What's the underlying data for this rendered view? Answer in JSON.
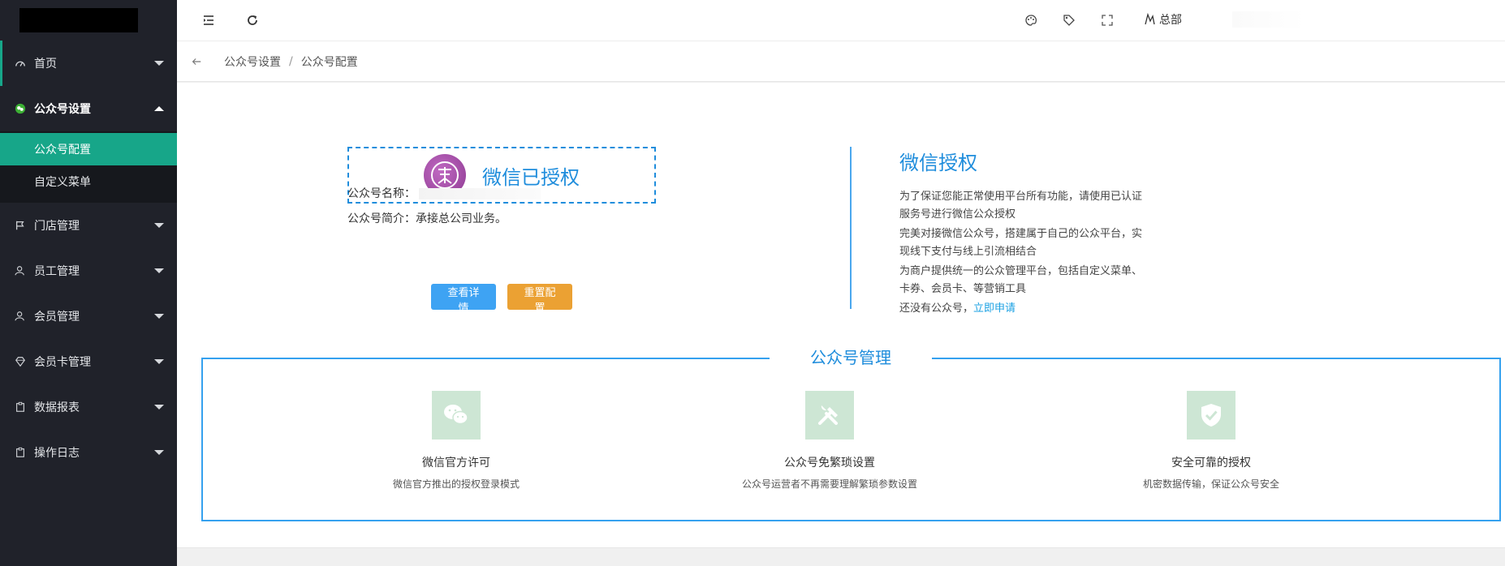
{
  "sidebar": {
    "items": [
      {
        "label": "首页",
        "icon": "dashboard-icon"
      },
      {
        "label": "公众号设置",
        "icon": "wechat-icon"
      },
      {
        "label": "门店管理",
        "icon": "flag-icon"
      },
      {
        "label": "员工管理",
        "icon": "user-icon"
      },
      {
        "label": "会员管理",
        "icon": "user-icon"
      },
      {
        "label": "会员卡管理",
        "icon": "diamond-icon"
      },
      {
        "label": "数据报表",
        "icon": "clipboard-icon"
      },
      {
        "label": "操作日志",
        "icon": "clipboard-icon"
      }
    ],
    "submenu": [
      {
        "label": "公众号配置"
      },
      {
        "label": "自定义菜单"
      }
    ]
  },
  "header": {
    "org_label": "总部"
  },
  "breadcrumb": {
    "items": [
      "公众号设置",
      "公众号配置"
    ],
    "separator": "/"
  },
  "auth": {
    "status_text": "微信已授权",
    "name_label": "公众号名称：",
    "intro_label": "公众号简介：",
    "intro_value": "承接总公司业务。",
    "view_button": "查看详情",
    "reset_button": "重置配置"
  },
  "info_panel": {
    "title": "微信授权",
    "p1": "为了保证您能正常使用平台所有功能，请使用已认证服务号进行微信公众授权",
    "p2": "完美对接微信公众号，搭建属于自己的公众平台，实现线下支付与线上引流相结合",
    "p3": "为商户提供统一的公众管理平台，包括自定义菜单、卡券、会员卡、等营销工具",
    "p4_prefix": "还没有公众号，",
    "p4_link": "立即申请"
  },
  "management": {
    "title": "公众号管理",
    "features": [
      {
        "title": "微信官方许可",
        "desc": "微信官方推出的授权登录模式",
        "icon": "wechat-chat-icon"
      },
      {
        "title": "公众号免繁琐设置",
        "desc": "公众号运营者不再需要理解繁琐参数设置",
        "icon": "tools-icon"
      },
      {
        "title": "安全可靠的授权",
        "desc": "机密数据传输，保证公众号安全",
        "icon": "shield-check-icon"
      }
    ]
  },
  "colors": {
    "accent_green": "#17a689",
    "brand_blue": "#1f8ddc",
    "button_blue": "#3ea3f3",
    "button_orange": "#eba133",
    "sidebar_bg": "#20222a"
  }
}
